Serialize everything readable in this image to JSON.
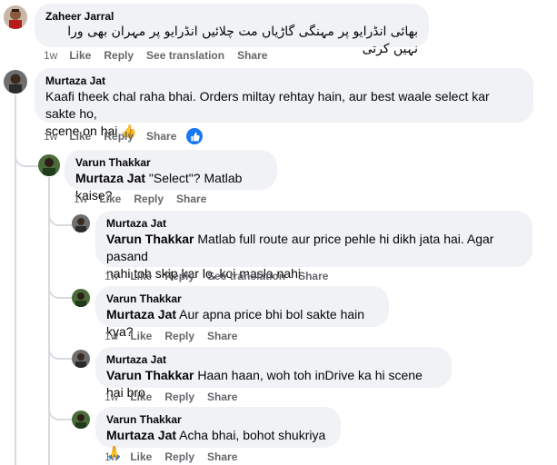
{
  "comments": [
    {
      "author": "Zaheer Jarral",
      "text": "بھائی انڈرایو پر مہنگی گاڑیاں مت چلائیں انڈرایو پر مہران بھی ورا نہیں کرتی",
      "time": "1w",
      "like": "Like",
      "reply": "Reply",
      "translate": "See translation",
      "share": "Share"
    },
    {
      "author": "Murtaza Jat",
      "text_line1": "Kaafi theek chal raha bhai. Orders miltay rehtay hain, aur best waale select kar sakte ho,",
      "text_line2": "scene on hai",
      "emoji": "👍",
      "time": "1w",
      "like": "Like",
      "reply": "Reply",
      "share": "Share",
      "reaction_icon": "like-reaction-icon"
    },
    {
      "author": "Varun Thakkar",
      "mention": "Murtaza Jat",
      "text": "\"Select\"? Matlab kaise?",
      "time": "1w",
      "like": "Like",
      "reply": "Reply",
      "share": "Share"
    },
    {
      "author": "Murtaza Jat",
      "mention": "Varun Thakkar",
      "text_line1": "Matlab full route aur price pehle hi dikh jata hai. Agar pasand",
      "text_line2": "nahi toh skip kar lo, koi masla nahi",
      "time": "1w",
      "like": "Like",
      "reply": "Reply",
      "translate": "See translation",
      "share": "Share"
    },
    {
      "author": "Varun Thakkar",
      "mention": "Murtaza Jat",
      "text": "Aur apna price bhi bol sakte hain kya?",
      "time": "1w",
      "like": "Like",
      "reply": "Reply",
      "share": "Share"
    },
    {
      "author": "Murtaza Jat",
      "mention": "Varun Thakkar",
      "text": "Haan haan, woh toh inDrive ka hi scene hai bro",
      "time": "1w",
      "like": "Like",
      "reply": "Reply",
      "share": "Share"
    },
    {
      "author": "Varun Thakkar",
      "mention": "Murtaza Jat",
      "text": "Acha bhai, bohot shukriya",
      "emoji": "🙏",
      "time": "1w",
      "like": "Like",
      "reply": "Reply",
      "share": "Share"
    }
  ],
  "colors": {
    "bubble": "#f0f2f5",
    "meta": "#65676b",
    "accent": "#1877f2",
    "thread": "#d8dadf"
  }
}
